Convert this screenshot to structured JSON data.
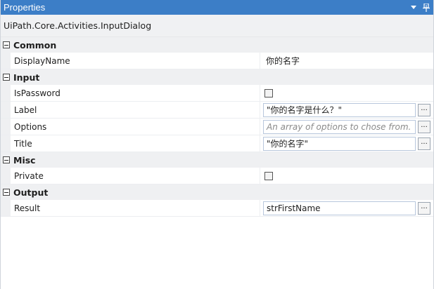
{
  "panel": {
    "title": "Properties"
  },
  "activity_type": "UiPath.Core.Activities.InputDialog",
  "icons": {
    "dropdown": "dropdown-arrow-icon",
    "pin": "pin-icon",
    "collapse": "collapse-minus-icon"
  },
  "colors": {
    "titlebar": "#3c7ec7",
    "category_bg": "#eff0f2",
    "textbox_border": "#b8c7dc"
  },
  "categories": {
    "common": {
      "label": "Common",
      "display_name": {
        "name": "DisplayName",
        "value": "你的名字"
      }
    },
    "input": {
      "label": "Input",
      "is_password": {
        "name": "IsPassword",
        "checked": false
      },
      "label_prop": {
        "name": "Label",
        "value": "\"你的名字是什么？\"",
        "button": "..."
      },
      "options": {
        "name": "Options",
        "value": "",
        "placeholder": "An array of options to chose from.",
        "button": "..."
      },
      "title": {
        "name": "Title",
        "value": "\"你的名字\"",
        "button": "..."
      }
    },
    "misc": {
      "label": "Misc",
      "private": {
        "name": "Private",
        "checked": false
      }
    },
    "output": {
      "label": "Output",
      "result": {
        "name": "Result",
        "value": "strFirstName",
        "button": "..."
      }
    }
  }
}
